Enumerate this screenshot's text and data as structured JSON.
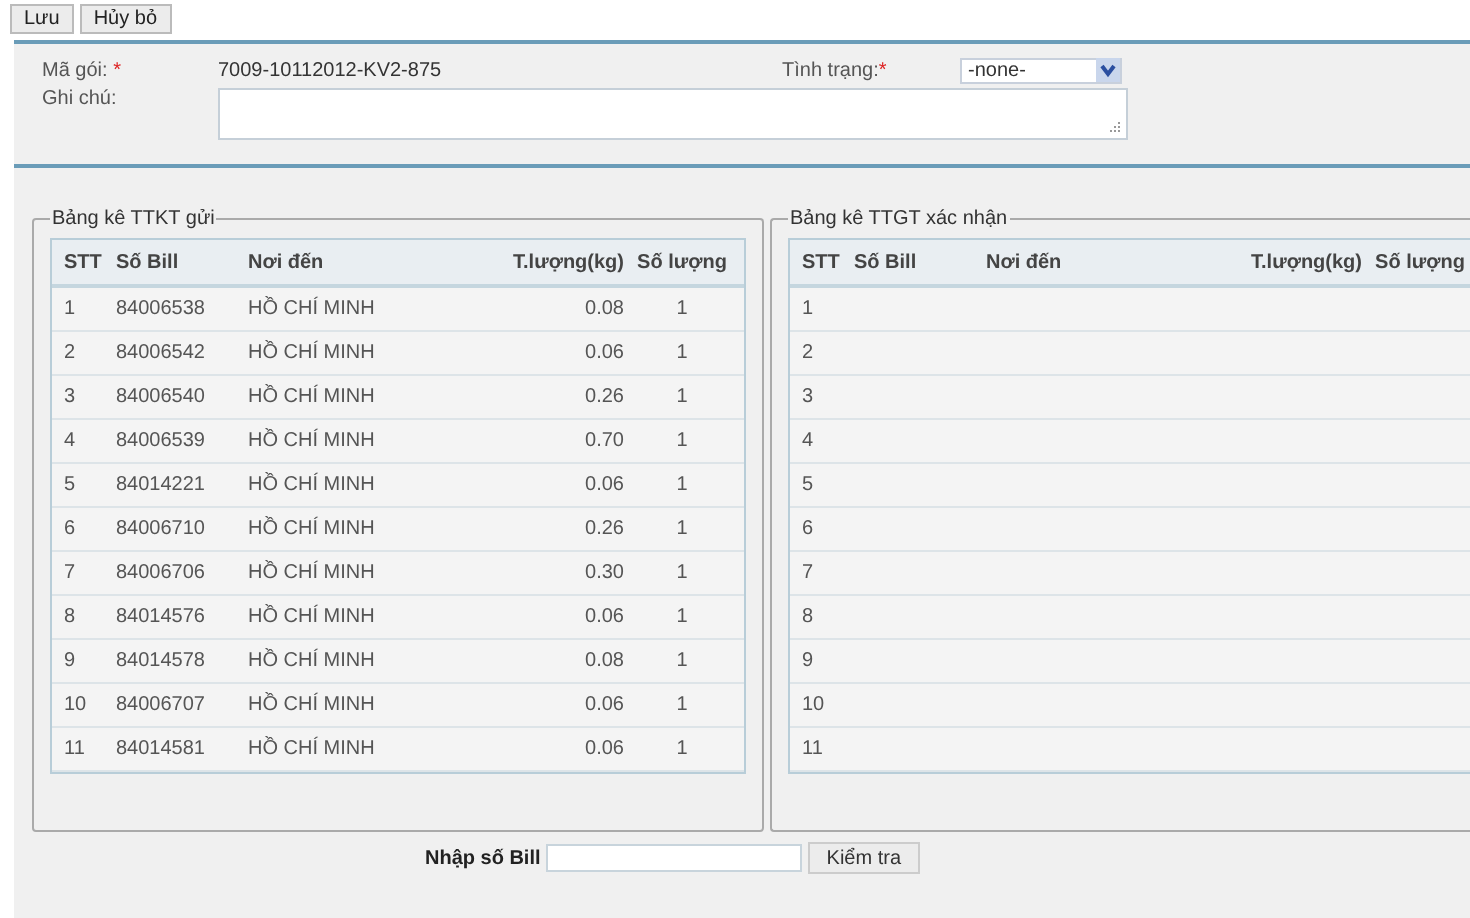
{
  "toolbar": {
    "buttons": [
      "Lưu",
      "Hủy bỏ"
    ]
  },
  "form": {
    "package_label": "Mã gói:",
    "package_required_mark": "*",
    "package_value": "7009-10112012-KV2-875",
    "status_label": "Tình trạng:",
    "status_required_mark": "*",
    "status_value": "-none-",
    "note_label": "Ghi chú:"
  },
  "left_table": {
    "title": "Bảng kê TTKT gửi",
    "columns": [
      "STT",
      "Số Bill",
      "Nơi đến",
      "T.lượng(kg)",
      "Số lượng"
    ],
    "rows": [
      {
        "stt": "1",
        "bill": "84006538",
        "dest": "HỒ CHÍ MINH",
        "weight": "0.08",
        "qty": "1"
      },
      {
        "stt": "2",
        "bill": "84006542",
        "dest": "HỒ CHÍ MINH",
        "weight": "0.06",
        "qty": "1"
      },
      {
        "stt": "3",
        "bill": "84006540",
        "dest": "HỒ CHÍ MINH",
        "weight": "0.26",
        "qty": "1"
      },
      {
        "stt": "4",
        "bill": "84006539",
        "dest": "HỒ CHÍ MINH",
        "weight": "0.70",
        "qty": "1"
      },
      {
        "stt": "5",
        "bill": "84014221",
        "dest": "HỒ CHÍ MINH",
        "weight": "0.06",
        "qty": "1"
      },
      {
        "stt": "6",
        "bill": "84006710",
        "dest": "HỒ CHÍ MINH",
        "weight": "0.26",
        "qty": "1"
      },
      {
        "stt": "7",
        "bill": "84006706",
        "dest": "HỒ CHÍ MINH",
        "weight": "0.30",
        "qty": "1"
      },
      {
        "stt": "8",
        "bill": "84014576",
        "dest": "HỒ CHÍ MINH",
        "weight": "0.06",
        "qty": "1"
      },
      {
        "stt": "9",
        "bill": "84014578",
        "dest": "HỒ CHÍ MINH",
        "weight": "0.08",
        "qty": "1"
      },
      {
        "stt": "10",
        "bill": "84006707",
        "dest": "HỒ CHÍ MINH",
        "weight": "0.06",
        "qty": "1"
      },
      {
        "stt": "11",
        "bill": "84014581",
        "dest": "HỒ CHÍ MINH",
        "weight": "0.06",
        "qty": "1"
      }
    ]
  },
  "right_table": {
    "title": "Bảng kê TTGT xác nhận",
    "columns": [
      "STT",
      "Số Bill",
      "Nơi đến",
      "T.lượng(kg)",
      "Số lượng"
    ],
    "rows": [
      {
        "stt": "1"
      },
      {
        "stt": "2"
      },
      {
        "stt": "3"
      },
      {
        "stt": "4"
      },
      {
        "stt": "5"
      },
      {
        "stt": "6"
      },
      {
        "stt": "7"
      },
      {
        "stt": "8"
      },
      {
        "stt": "9"
      },
      {
        "stt": "10"
      },
      {
        "stt": "11"
      }
    ]
  },
  "bill_entry": {
    "label": "Nhập số Bill",
    "button": "Kiểm tra"
  }
}
